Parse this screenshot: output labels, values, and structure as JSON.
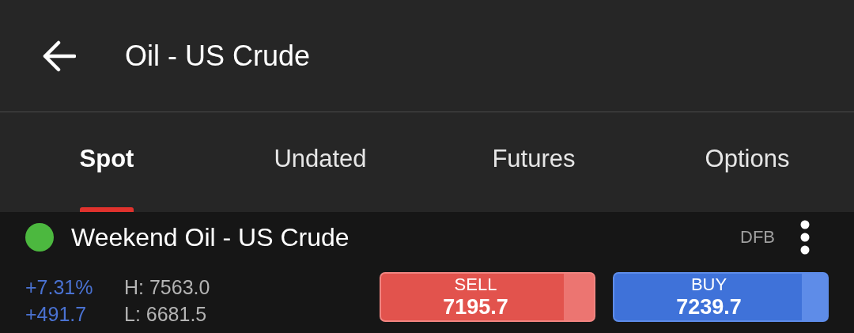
{
  "header": {
    "title": "Oil - US Crude"
  },
  "tabs": [
    {
      "label": "Spot",
      "selected": true
    },
    {
      "label": "Undated",
      "selected": false
    },
    {
      "label": "Futures",
      "selected": false
    },
    {
      "label": "Options",
      "selected": false
    }
  ],
  "market": {
    "name": "Weekend Oil - US Crude",
    "color": "#4cb83f",
    "tag": "DFB",
    "change_percent": "+7.31%",
    "change_points": "+491.7",
    "high": "H: 7563.0",
    "low": "L: 6681.5",
    "prices": [
      {
        "kind": "sell",
        "label": "SELL",
        "value": "7195.7"
      },
      {
        "kind": "buy",
        "label": "BUY",
        "value": "7239.7"
      }
    ]
  }
}
